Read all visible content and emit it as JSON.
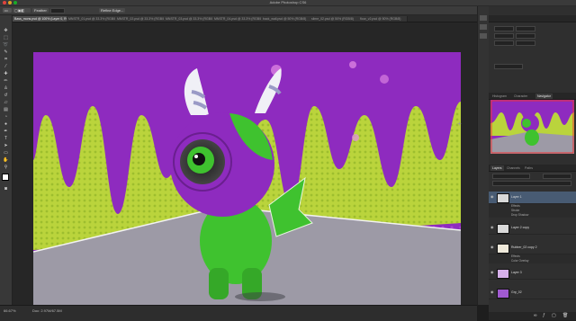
{
  "window": {
    "title": "Adobe Photoshop CS6"
  },
  "options_bar": {
    "items": [
      "Feather",
      "Refine Edge...",
      "Essentials"
    ]
  },
  "tabs": [
    {
      "label": "Bass_mons.psd @ 100% (Layer 0, RGB/8)",
      "active": true
    },
    {
      "label": "MNSTR_01.psd @ 33.3% (RGB/8)",
      "active": false
    },
    {
      "label": "MNSTR_02.psd @ 33.3% (RGB/8)",
      "active": false
    },
    {
      "label": "MNSTR_03.psd @ 33.3% (RGB/8)",
      "active": false
    },
    {
      "label": "MNSTR_04.psd @ 33.3% (RGB/8)",
      "active": false
    },
    {
      "label": "back_wall.psd @ 50% (RGB/8)",
      "active": false
    },
    {
      "label": "slime_02.psd @ 50% (RGB/8)",
      "active": false
    },
    {
      "label": "floor_v2.psd @ 50% (RGB/8)",
      "active": false
    }
  ],
  "statusbar": {
    "zoom": "66.67%",
    "doc": "Doc: 2.97M/67.5M"
  },
  "navigator_panel": {
    "tabs": [
      "Histogram",
      "Character",
      "Navigator"
    ]
  },
  "layers_panel": {
    "tabs": [
      "Layers",
      "Channels",
      "Paths"
    ],
    "layers": [
      {
        "name": "Layer 1",
        "selected": true
      },
      {
        "name": "Layer 2 copy",
        "selected": false
      },
      {
        "name": "Rubber_02 copy 2",
        "selected": false
      },
      {
        "name": "Layer 3",
        "selected": false
      },
      {
        "name": "Grp_02",
        "selected": false
      }
    ],
    "effects": [
      "Effects",
      "Stroke",
      "Drop Shadow"
    ],
    "effects2": [
      "Effects",
      "Color Overlay"
    ]
  },
  "colors": {
    "accent_purple": "#9b2fc7",
    "slime_green": "#b8d43a",
    "monster_green": "#3fc22f"
  }
}
